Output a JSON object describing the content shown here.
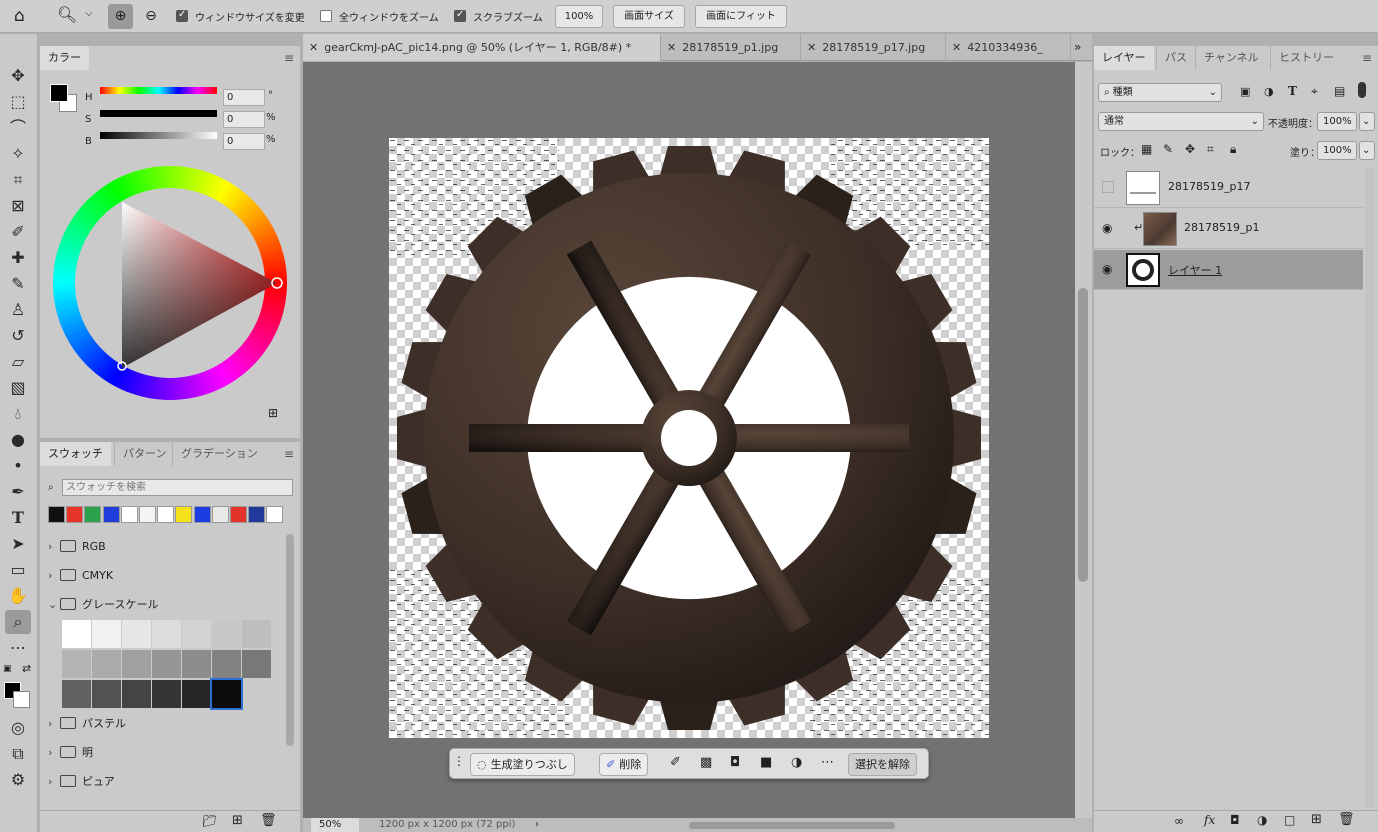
{
  "options_bar": {
    "resize_windows_label": "ウィンドウサイズを変更",
    "zoom_all_windows_label": "全ウィンドウをズーム",
    "scrubby_zoom_label": "スクラブズーム",
    "zoom_100_label": "100%",
    "fill_screen_label": "画面サイズ",
    "fit_screen_label": "画面にフィット"
  },
  "color_panel": {
    "tab": "カラー",
    "h_label": "H",
    "h_value": "0",
    "h_unit": "°",
    "s_label": "S",
    "s_value": "0",
    "s_unit": "%",
    "b_label": "B",
    "b_value": "0",
    "b_unit": "%"
  },
  "swatches_panel": {
    "tabs": [
      "スウォッチ",
      "パターン",
      "グラデーション"
    ],
    "search_placeholder": "スウォッチを検索",
    "recent_colors": [
      "#111111",
      "#e8352a",
      "#2ba24c",
      "#1f3ddb",
      "#ffffff",
      "#f4f4f4",
      "#ffffff",
      "#f6e21b",
      "#1c3ce0",
      "#e8e8e8",
      "#e2332a",
      "#1f3a9a",
      "#ffffff"
    ],
    "folders": {
      "rgb": "RGB",
      "cmyk": "CMYK",
      "grayscale": "グレースケール",
      "pastel": "パステル",
      "light": "明",
      "pure": "ピュア"
    },
    "gray_row1": [
      "#ffffff",
      "#f1f1f1",
      "#e6e6e6",
      "#dcdcdc",
      "#d2d2d2",
      "#c8c8c8",
      "#bebebe"
    ],
    "gray_row2": [
      "#b4b4b4",
      "#aaaaaa",
      "#a0a0a0",
      "#969696",
      "#8c8c8c",
      "#828282",
      "#787878"
    ],
    "gray_row3": [
      "#626262",
      "#525252",
      "#444444",
      "#353535",
      "#262626",
      "#0b0b0b"
    ]
  },
  "document": {
    "tabs": [
      "gearCkmJ-pAC_pic14.png @ 50% (レイヤー 1, RGB/8#) *",
      "28178519_p1.jpg",
      "28178519_p17.jpg",
      "4210334936_"
    ],
    "zoom": "50%",
    "dimensions": "1200 px x 1200 px (72 ppi)"
  },
  "context_bar": {
    "generative_fill": "生成塗りつぶし",
    "delete": "削除",
    "deselect": "選択を解除"
  },
  "layers_panel": {
    "tabs": [
      "レイヤー",
      "パス",
      "チャンネル",
      "ヒストリー"
    ],
    "filter_kind": "種類",
    "blend_mode": "通常",
    "opacity_label": "不透明度：",
    "opacity_value": "100%",
    "lock_label": "ロック：",
    "fill_label": "塗り：",
    "fill_value": "100%",
    "layers": [
      {
        "name": "28178519_p17",
        "visible": false
      },
      {
        "name": "28178519_p1",
        "visible": true
      },
      {
        "name": "レイヤー 1",
        "visible": true,
        "selected": true
      }
    ]
  },
  "colors": {
    "gear": "#3a2c24",
    "canvas_bg": "#727272"
  }
}
